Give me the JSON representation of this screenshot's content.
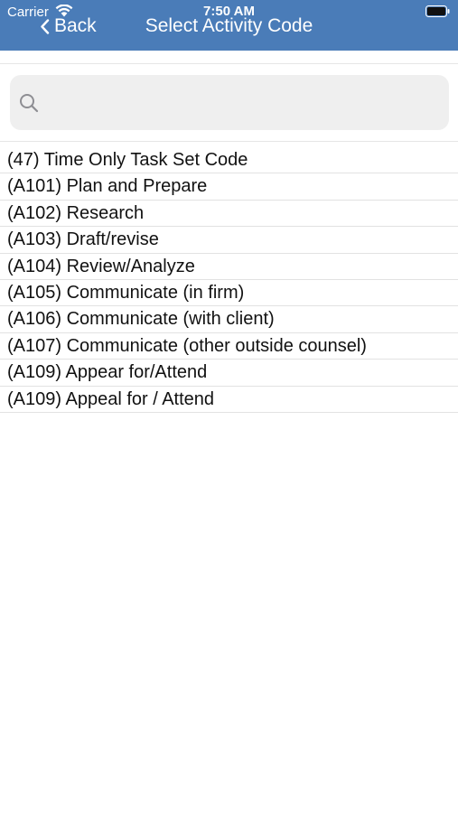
{
  "status_bar": {
    "carrier": "Carrier",
    "time": "7:50 AM",
    "wifi_icon": "wifi-icon",
    "battery_icon": "battery-icon"
  },
  "nav": {
    "back_label": "Back",
    "title": "Select Activity Code",
    "background_color": "#4a7cb8"
  },
  "search": {
    "icon": "search-icon",
    "placeholder": "",
    "value": ""
  },
  "activity_codes": [
    "(47) Time Only Task Set Code",
    "(A101) Plan and Prepare",
    "(A102) Research",
    "(A103) Draft/revise",
    "(A104) Review/Analyze",
    "(A105) Communicate (in firm)",
    "(A106) Communicate (with client)",
    "(A107) Communicate (other outside counsel)",
    "(A109) Appear for/Attend",
    "(A109) Appeal for / Attend"
  ]
}
